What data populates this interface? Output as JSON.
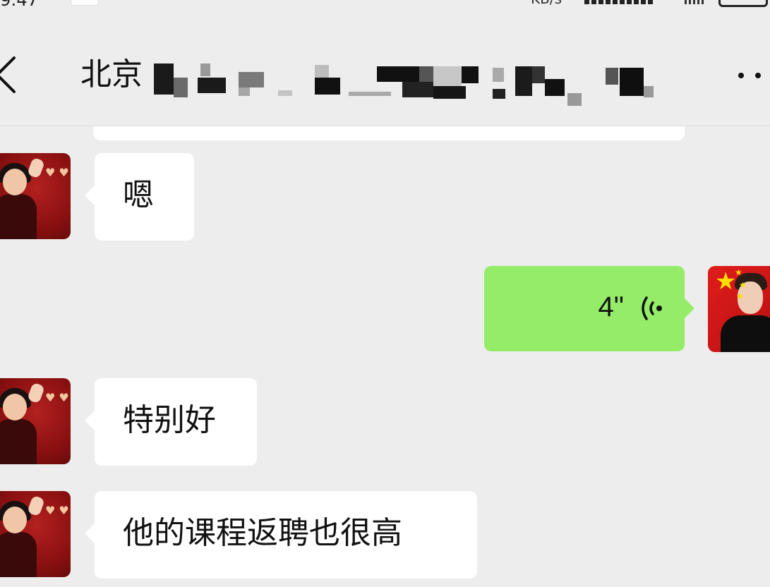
{
  "status_bar": {
    "time": "9:47",
    "network_speed": "KB/s"
  },
  "header": {
    "back_icon": "chevron-left-icon",
    "title_visible": "北京",
    "more_icon": "more-dots-icon"
  },
  "messages": [
    {
      "sender": "contact",
      "type": "text",
      "text": "嗯"
    },
    {
      "sender": "self",
      "type": "voice",
      "duration": "4\""
    },
    {
      "sender": "contact",
      "type": "text",
      "text": "特别好"
    },
    {
      "sender": "contact",
      "type": "text",
      "text": "他的课程返聘也很高"
    }
  ],
  "colors": {
    "background": "#ededed",
    "bubble_incoming": "#ffffff",
    "bubble_outgoing": "#95ec69",
    "text": "#111111"
  }
}
